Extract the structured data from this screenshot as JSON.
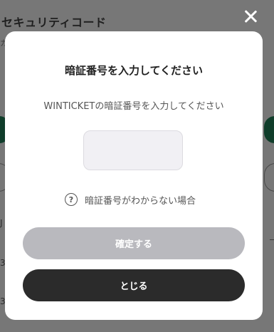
{
  "background": {
    "title": "セキュリティコード",
    "small_text": "カ",
    "letter_j": "J",
    "num_a": "3",
    "num_b": "3"
  },
  "close_icon": "close-icon",
  "modal": {
    "title": "暗証番号を入力してください",
    "description": "WINTICKETの暗証番号を入力してください",
    "code_input_value": "",
    "help_text": "暗証番号がわからない場合",
    "help_icon_glyph": "?",
    "confirm_button": "確定する",
    "close_button": "とじる"
  },
  "colors": {
    "confirm_disabled": "#b9b9be",
    "close_button": "#2b2b2b",
    "overlay": "#777777",
    "brand_green": "#0f3d2a"
  }
}
